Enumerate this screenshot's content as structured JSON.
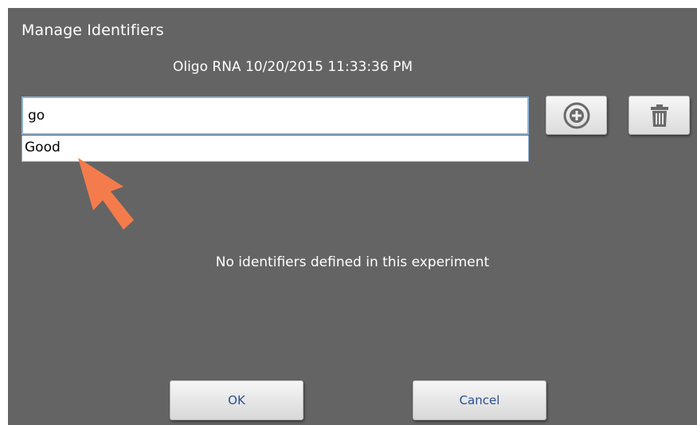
{
  "dialog": {
    "title": "Manage Identifiers",
    "subtitle": "Oligo RNA 10/20/2015 11:33:36 PM",
    "background_color": "#646464"
  },
  "search": {
    "value": "go",
    "suggestions": [
      "Good"
    ]
  },
  "toolbar": {
    "add_icon": "plus-circle-icon",
    "delete_icon": "trash-icon"
  },
  "main": {
    "empty_message": "No identifiers defined in this experiment"
  },
  "footer": {
    "ok_label": "OK",
    "cancel_label": "Cancel"
  },
  "annotation": {
    "arrow_color": "#f47c4c"
  }
}
